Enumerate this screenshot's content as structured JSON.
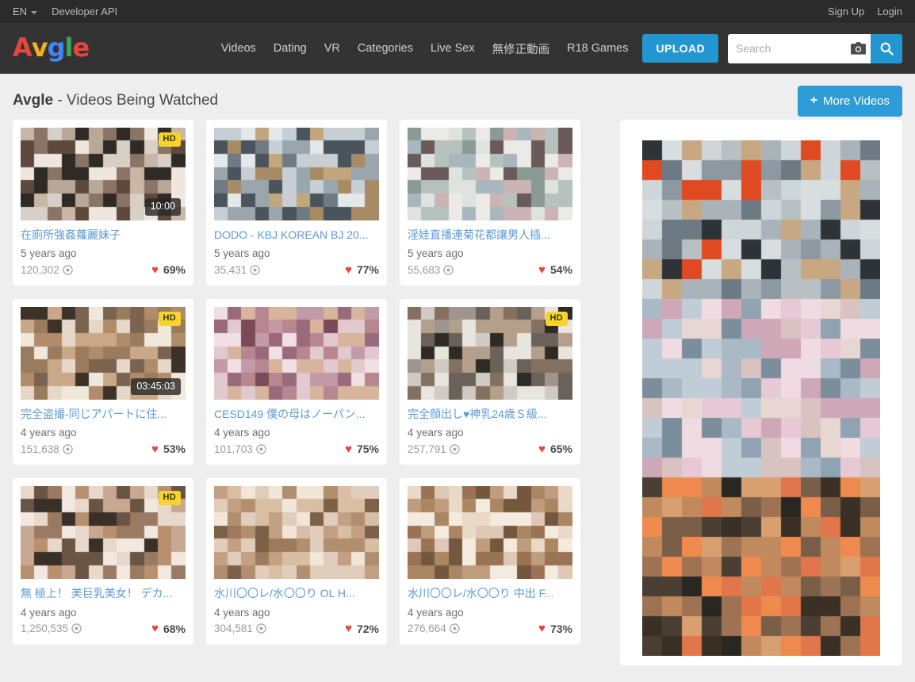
{
  "topbar": {
    "language": "EN",
    "developer_api": "Developer API",
    "sign_up": "Sign Up",
    "login": "Login"
  },
  "brand": {
    "letters": [
      {
        "char": "A",
        "color": "#e8453c"
      },
      {
        "char": "v",
        "color": "#f2b01e"
      },
      {
        "char": "g",
        "color": "#4285f4"
      },
      {
        "char": "l",
        "color": "#3aa757"
      },
      {
        "char": "e",
        "color": "#e8453c"
      }
    ]
  },
  "nav": {
    "items": [
      {
        "label": "Videos"
      },
      {
        "label": "Dating"
      },
      {
        "label": "VR"
      },
      {
        "label": "Categories"
      },
      {
        "label": "Live Sex"
      },
      {
        "label": "無修正動画"
      },
      {
        "label": "R18 Games"
      }
    ],
    "upload_label": "UPLOAD",
    "search_placeholder": "Search"
  },
  "page": {
    "title_bold": "Avgle",
    "title_rest": " - Videos Being Watched",
    "more_videos_label": "More Videos",
    "more_videos_plus": "+"
  },
  "videos": [
    {
      "title": "在廁所強姦蘿麗妹子",
      "age": "5 years ago",
      "views": "120,302",
      "likes": "69%",
      "duration": "10:00",
      "hd": "HD",
      "seed": 11
    },
    {
      "title": "DODO - KBJ KOREAN BJ 20...",
      "age": "5 years ago",
      "views": "35,431",
      "likes": "77%",
      "duration": "",
      "hd": "",
      "seed": 22
    },
    {
      "title": "淫娃直播連菊花都讓男人插...",
      "age": "5 years ago",
      "views": "55,683",
      "likes": "54%",
      "duration": "",
      "hd": "",
      "seed": 33
    },
    {
      "title": "完全盗撮-同じアパートに住...",
      "age": "4 years ago",
      "views": "151,638",
      "likes": "53%",
      "duration": "03:45:03",
      "hd": "HD",
      "seed": 44
    },
    {
      "title": "CESD149 僕の母はノーパン...",
      "age": "4 years ago",
      "views": "101,703",
      "likes": "75%",
      "duration": "",
      "hd": "",
      "seed": 55
    },
    {
      "title": "完全顔出し♥神乳24歳Ｓ級...",
      "age": "4 years ago",
      "views": "257,791",
      "likes": "65%",
      "duration": "",
      "hd": "HD",
      "seed": 66
    },
    {
      "title": "無 極上！ 美巨乳美女！ デカ...",
      "age": "4 years ago",
      "views": "1,250,535",
      "likes": "68%",
      "duration": "",
      "hd": "HD",
      "seed": 77
    },
    {
      "title": "水川〇〇レ/水〇〇り OL H...",
      "age": "4 years ago",
      "views": "304,581",
      "likes": "72%",
      "duration": "",
      "hd": "",
      "seed": 88
    },
    {
      "title": "水川〇〇レ/水〇〇り 中出 F...",
      "age": "4 years ago",
      "views": "276,664",
      "likes": "73%",
      "duration": "",
      "hd": "",
      "seed": 99
    }
  ],
  "colors": {
    "accent_blue": "#2296d1",
    "link_blue": "#5b9bd5",
    "heart_red": "#e8453c",
    "hd_yellow": "#f6d32d",
    "page_bg": "#eeeeee",
    "nav_bg": "#333333",
    "topbar_bg": "#2b2b2b"
  },
  "icons": {
    "camera": "camera-icon",
    "search": "search-icon",
    "eye": "views-icon",
    "heart": "heart-icon",
    "caret": "chevron-down-icon"
  }
}
